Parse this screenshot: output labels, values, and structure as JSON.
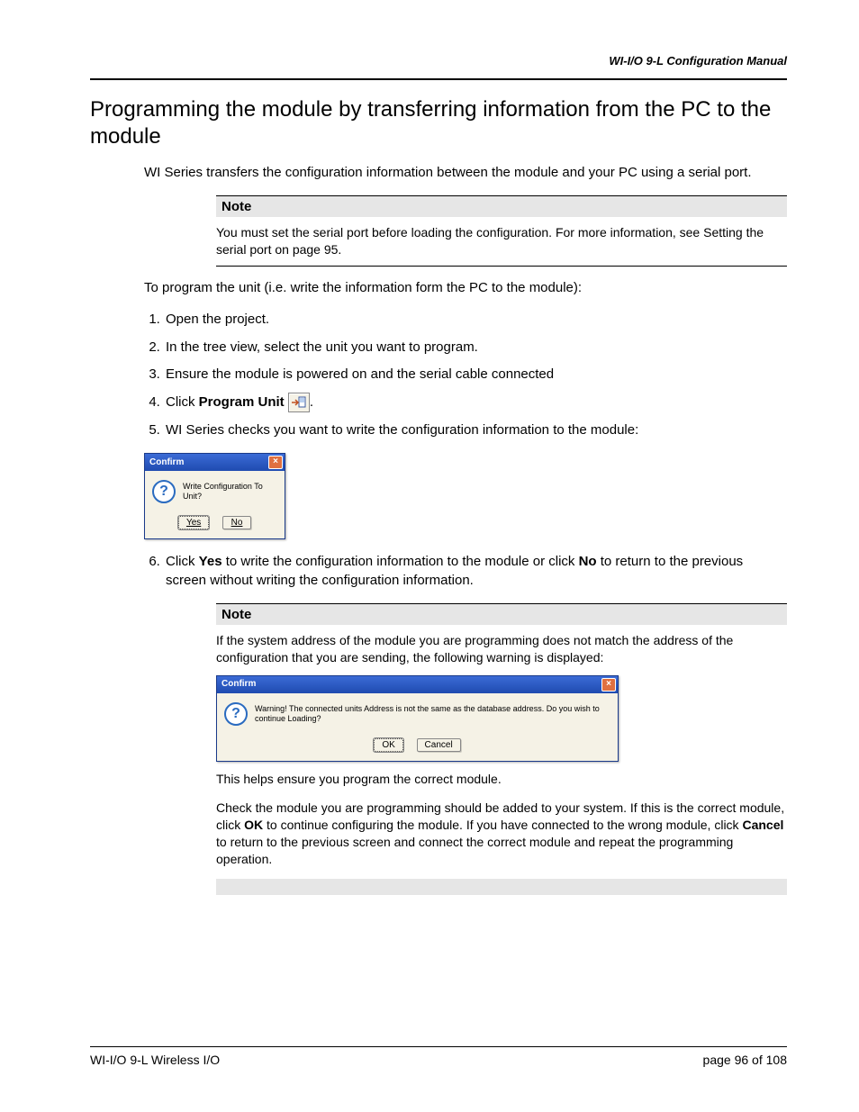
{
  "header": {
    "manual_title": "WI-I/O 9-L Configuration Manual"
  },
  "title": "Programming the module by transferring information from the PC to the module",
  "intro": "WI Series transfers the configuration information between the module and your PC using a serial port.",
  "note1": {
    "label": "Note",
    "text": "You must set the serial port before loading the configuration. For more information, see Setting the serial port on page 95."
  },
  "lead_in": "To program the unit (i.e. write the information form the PC to the module):",
  "steps": {
    "s1": "Open the project.",
    "s2": "In the tree view, select the unit you want to program.",
    "s3": "Ensure the module is powered on and the serial cable connected",
    "s4_prefix": "Click ",
    "s4_bold": "Program Unit",
    "s4_suffix": ".",
    "s5": "WI Series checks you want to write the configuration information to the module:",
    "s6_a": "Click ",
    "s6_yes": "Yes",
    "s6_b": " to write the configuration information to the module or click ",
    "s6_no": "No",
    "s6_c": " to return to the previous screen without writing the configuration information."
  },
  "dialog1": {
    "title": "Confirm",
    "message": "Write Configuration To Unit?",
    "yes": "Yes",
    "no": "No"
  },
  "note2": {
    "label": "Note",
    "p1": "If the system address of the module you are programming does not match the address of the configuration that you are sending, the following warning is displayed:",
    "p2": "This helps ensure you program the correct module.",
    "p3_a": "Check the module you are programming should be added to your system. If this is the correct module, click ",
    "p3_ok": "OK",
    "p3_b": " to continue configuring the module. If you have connected to the wrong module, click ",
    "p3_cancel": "Cancel",
    "p3_c": " to return to the previous screen and connect the correct module and repeat the programming operation."
  },
  "dialog2": {
    "title": "Confirm",
    "message": "Warning! The connected units Address is not the same as the database address.  Do you wish to continue Loading?",
    "ok": "OK",
    "cancel": "Cancel"
  },
  "footer": {
    "left": "WI-I/O 9-L Wireless I/O",
    "right_prefix": "page ",
    "page": "96",
    "right_suffix": " of 108"
  }
}
